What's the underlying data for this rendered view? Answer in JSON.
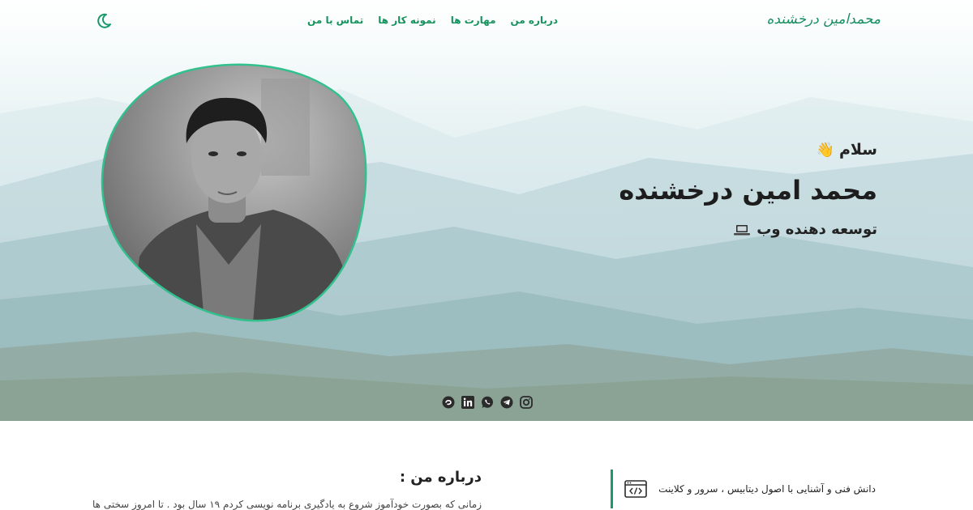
{
  "header": {
    "logo": "محمدامین درخشنده",
    "menu": [
      "درباره من",
      "مهارت ها",
      "نمونه کار ها",
      "تماس با من"
    ]
  },
  "intro": {
    "greeting": "سلام",
    "greeting_emoji": "👋",
    "name": "محمد امین درخشنده",
    "role": "توسعه دهنده وب",
    "role_icon": "laptop-icon"
  },
  "social": [
    "instagram-icon",
    "telegram-icon",
    "whatsapp-icon",
    "linkedin-icon",
    "virgool-icon"
  ],
  "about": {
    "title": "درباره من :",
    "text": "زمانی که بصورت خودآموز شروع به یادگیری برنامه نویسی کردم ۱۹ سال بود . تا امروز سختی های زیادی"
  },
  "skill": {
    "icon": "code-window-icon",
    "text": "دانش فنی و آشنایی با اصول دیتابیس ، سرور و کلاینت"
  },
  "colors": {
    "accent": "#1a9a6a",
    "text": "#222222"
  }
}
